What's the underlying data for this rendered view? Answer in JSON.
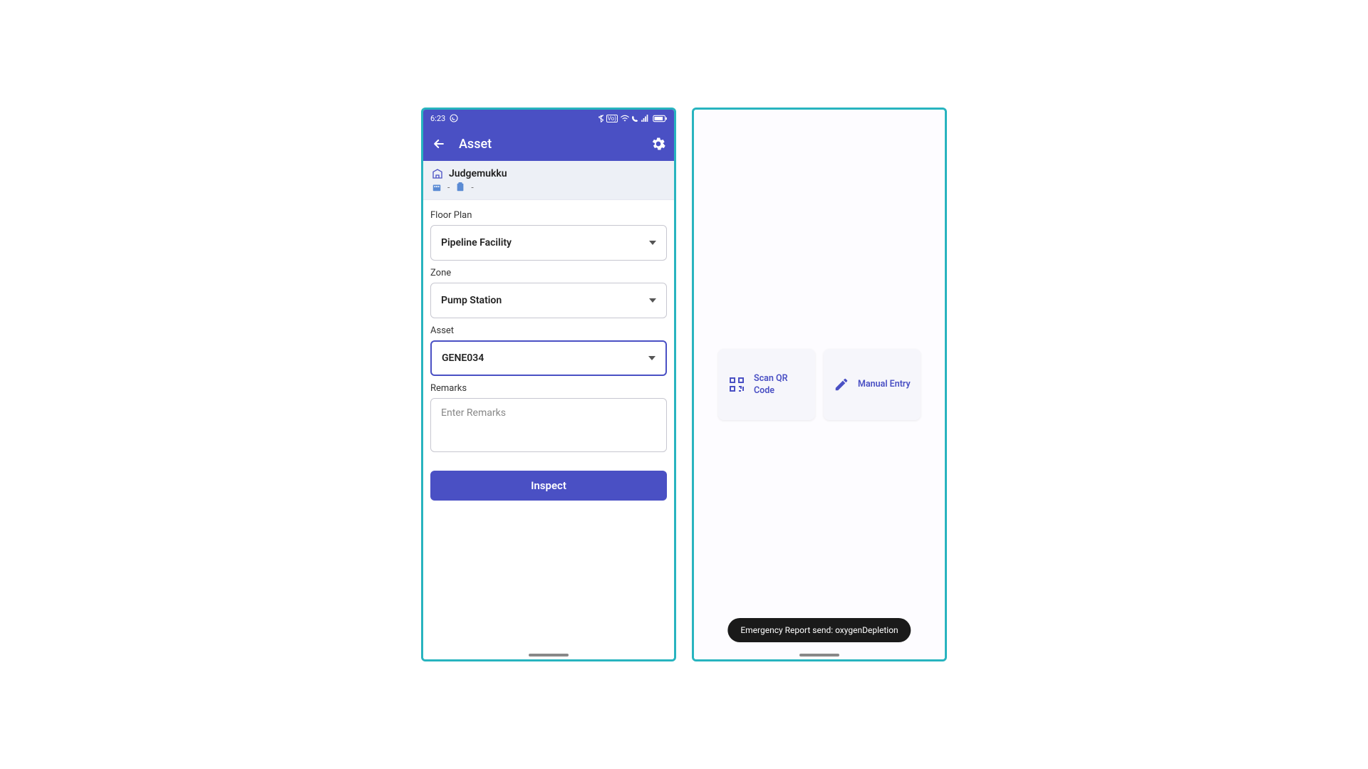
{
  "phone1": {
    "status": {
      "time": "6:23",
      "whatsapp_icon": "whatsapp"
    },
    "appbar": {
      "title": "Asset"
    },
    "location": {
      "name": "Judgemukku",
      "sub1": "-",
      "sub2": "-"
    },
    "form": {
      "floor_plan_label": "Floor Plan",
      "floor_plan_value": "Pipeline Facility",
      "zone_label": "Zone",
      "zone_value": "Pump Station",
      "asset_label": "Asset",
      "asset_value": "GENE034",
      "remarks_label": "Remarks",
      "remarks_placeholder": "Enter Remarks",
      "inspect_button": "Inspect"
    }
  },
  "phone2": {
    "cards": {
      "scan_qr": "Scan QR Code",
      "manual_entry": "Manual Entry"
    },
    "toast": "Emergency Report send: oxygenDepletion"
  }
}
